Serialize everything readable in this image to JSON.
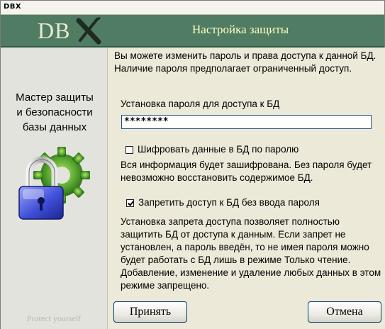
{
  "window": {
    "title": "DBX"
  },
  "header": {
    "logo_text": "DB",
    "title": "Настройка защиты"
  },
  "sidebar": {
    "title_lines": [
      "Мастер защиты",
      "и безопасности",
      "базы данных"
    ],
    "footer": "Protect yourself"
  },
  "content": {
    "intro": "Вы можете изменить пароль и права доступа к данной БД. Наличие пароля предполагает ограниченный доступ.",
    "password_label": "Установка пароля для доступа к БД",
    "password_value": "********",
    "encrypt_label": "Шифровать данные в БД по паролю",
    "encrypt_checked": false,
    "encrypt_desc": "Вся информация будет зашифрована. Без пароля будет невозможно восстановить содержимое БД.",
    "deny_label": "Запретить доступ к БД без ввода пароля",
    "deny_checked": true,
    "deny_desc": "Установка запрета доступа позволяет полностью защитить БД от доступа к данным. Если запрет не установлен, а пароль введён, то не имея пароля можно будет работать с БД лишь в режиме Только чтение. Добавление, изменение и удаление любых данных в этом режиме запрещено."
  },
  "buttons": {
    "accept": "Принять",
    "cancel": "Отмена"
  },
  "colors": {
    "header_bg": "#4f7c62",
    "header_title": "#ffffc0",
    "sidebar_bg": "#e2e3dd",
    "button_border": "#003c74"
  },
  "icons": [
    "lock-gear-icon",
    "logo-x-icon",
    "checkbox-icon"
  ]
}
